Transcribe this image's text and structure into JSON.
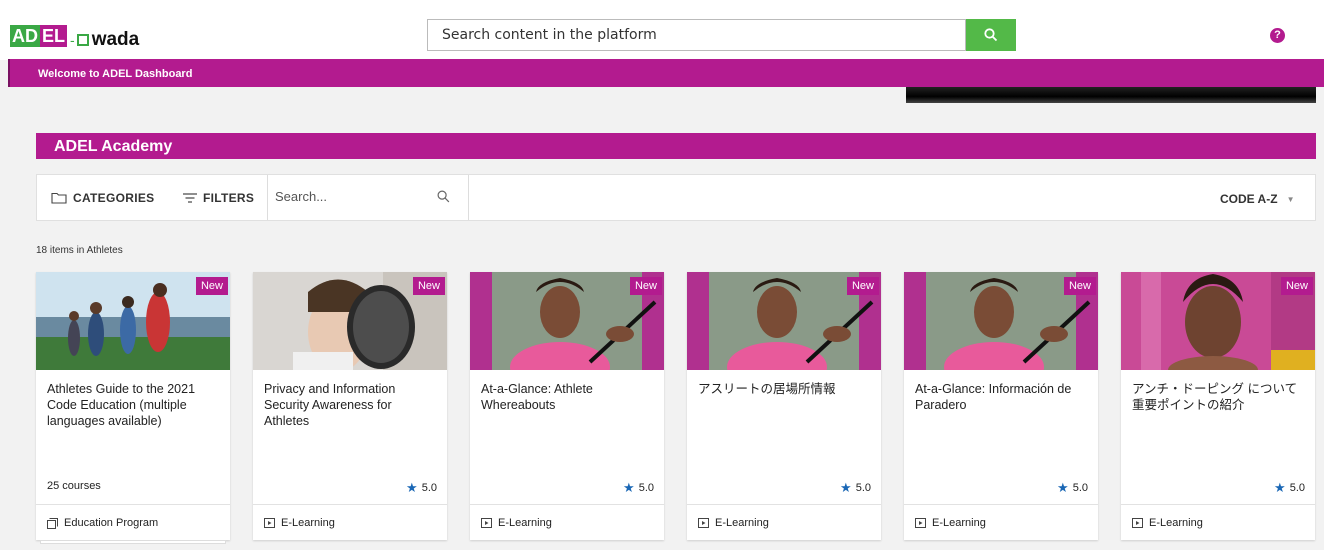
{
  "header": {
    "logo_ad": "AD",
    "logo_el": "EL",
    "logo_wada": "wada",
    "search_placeholder": "Search content in the platform",
    "help_label": "?"
  },
  "welcome_text": "Welcome to ADEL Dashboard",
  "section_title": "ADEL Academy",
  "toolbar": {
    "categories_label": "CATEGORIES",
    "filters_label": "FILTERS",
    "search_placeholder": "Search...",
    "sort_label": "CODE A-Z"
  },
  "items_count": "18 items in Athletes",
  "cards": [
    {
      "badge": "New",
      "title": "Athletes Guide to the 2021 Code Education (multiple languages available)",
      "meta": "25 courses",
      "rating": "",
      "type": "Education Program",
      "type_icon": "program-icon"
    },
    {
      "badge": "New",
      "title": "Privacy and Information Security Awareness for Athletes",
      "meta": "",
      "rating": "5.0",
      "type": "E-Learning",
      "type_icon": "elearning-icon"
    },
    {
      "badge": "New",
      "title": "At-a-Glance: Athlete Whereabouts",
      "meta": "",
      "rating": "5.0",
      "type": "E-Learning",
      "type_icon": "elearning-icon"
    },
    {
      "badge": "New",
      "title": "アスリートの居場所情報",
      "meta": "",
      "rating": "5.0",
      "type": "E-Learning",
      "type_icon": "elearning-icon"
    },
    {
      "badge": "New",
      "title": "At-a-Glance: Información de Paradero",
      "meta": "",
      "rating": "5.0",
      "type": "E-Learning",
      "type_icon": "elearning-icon"
    },
    {
      "badge": "New",
      "title": "アンチ・ドーピング について 重要ポイントの紹介",
      "meta": "",
      "rating": "5.0",
      "type": "E-Learning",
      "type_icon": "elearning-icon"
    }
  ],
  "colors": {
    "brand": "#b31b8f",
    "accent_green": "#53b948",
    "star": "#1a67b5"
  }
}
